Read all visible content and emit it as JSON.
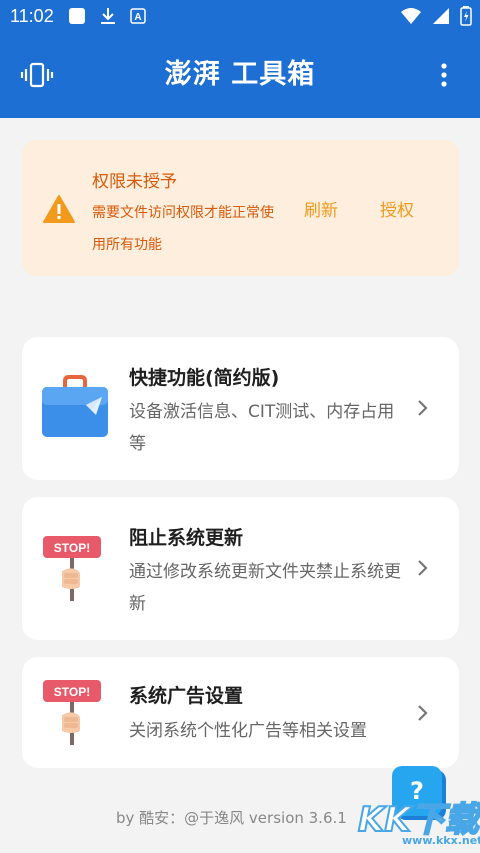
{
  "status_bar": {
    "time": "11:02",
    "left_icons": [
      "square-notification-icon",
      "download-icon",
      "app-a-icon"
    ],
    "right_icons": [
      "wifi-icon",
      "signal-icon",
      "battery-icon"
    ]
  },
  "app_bar": {
    "title": "澎湃 工具箱",
    "left_icon": "vibrate-icon",
    "right_icon": "more-vert-icon",
    "color": "#1e6fd3"
  },
  "permission_alert": {
    "title": "权限未授予",
    "description": "需要文件访问权限才能正常使用所有功能",
    "refresh_label": "刷新",
    "grant_label": "授权",
    "icon": "warning-icon",
    "colors": {
      "background": "#fdeedd",
      "text": "#d85a0a",
      "action": "#f29a1c"
    }
  },
  "cards": [
    {
      "title": "快捷功能(简约版)",
      "description": "设备激活信息、CIT测试、内存占用等",
      "icon": "briefcase-icon"
    },
    {
      "title": "阻止系统更新",
      "description": "通过修改系统更新文件夹禁止系统更新",
      "icon": "stop-sign-icon"
    },
    {
      "title": "系统广告设置",
      "description": "关闭系统个性化广告等相关设置",
      "icon": "stop-sign-icon"
    }
  ],
  "footer": {
    "text": "by 酷安：@于逸风 version 3.6.1"
  },
  "help_button": {
    "label": "?"
  },
  "watermark": {
    "text": "KK下载",
    "url": "www.kkx.net"
  }
}
